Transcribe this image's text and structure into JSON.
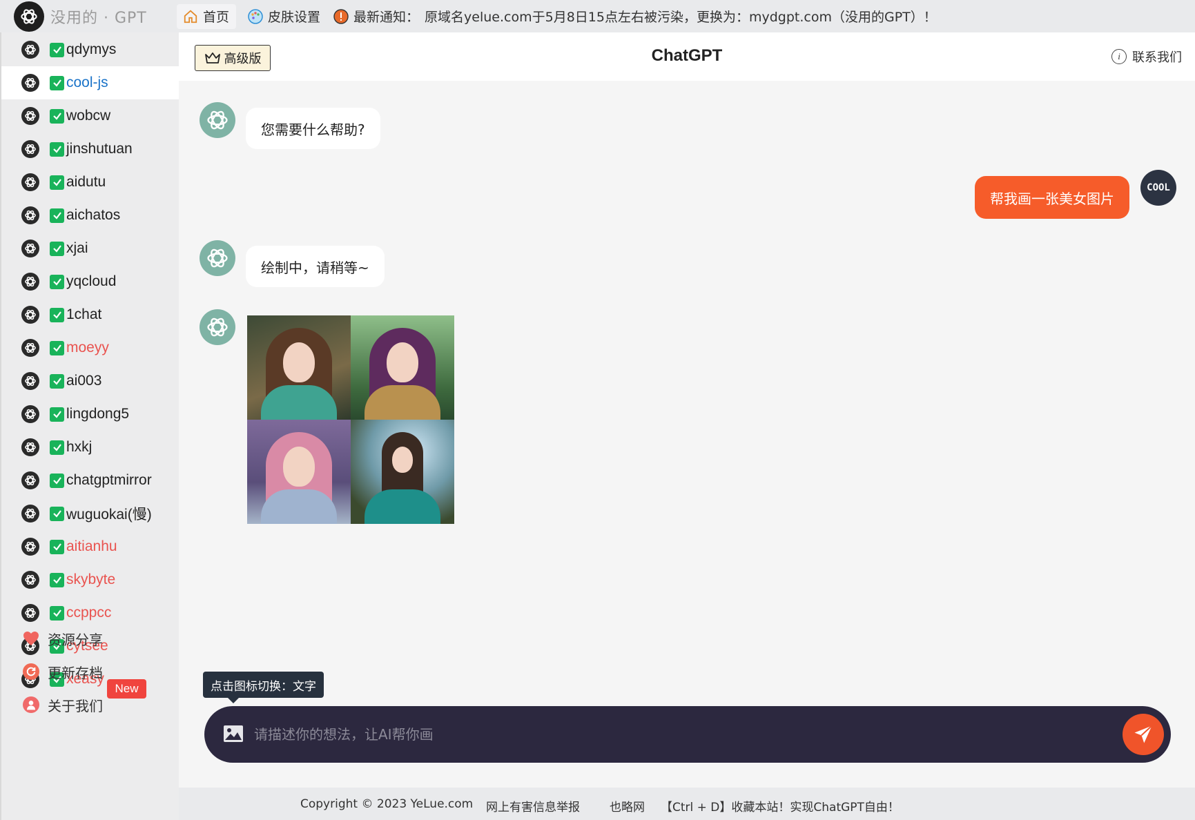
{
  "brand": {
    "name": "没用的 · GPT",
    "logo_icon": "openai-logo-icon"
  },
  "topnav": {
    "home": "首页",
    "skin": "皮肤设置",
    "notice_label": "最新通知：",
    "notice_text": "原域名yelue.com于5月8日15点左右被污染，更换为：mydgpt.com（没用的GPT）！"
  },
  "sidebar": {
    "items": [
      {
        "label": "qdymys",
        "color": "#222222"
      },
      {
        "label": "cool-js",
        "color": "#1a73c8",
        "active": true
      },
      {
        "label": "wobcw",
        "color": "#222222"
      },
      {
        "label": "jinshutuan",
        "color": "#222222"
      },
      {
        "label": "aidutu",
        "color": "#222222"
      },
      {
        "label": "aichatos",
        "color": "#222222"
      },
      {
        "label": "xjai",
        "color": "#222222"
      },
      {
        "label": "yqcloud",
        "color": "#222222"
      },
      {
        "label": "1chat",
        "color": "#222222"
      },
      {
        "label": "moeyy",
        "color": "#e9534f"
      },
      {
        "label": "ai003",
        "color": "#222222"
      },
      {
        "label": "lingdong5",
        "color": "#222222"
      },
      {
        "label": "hxkj",
        "color": "#222222"
      },
      {
        "label": "chatgptmirror",
        "color": "#222222"
      },
      {
        "label": "wuguokai(慢)",
        "color": "#222222"
      },
      {
        "label": "aitianhu",
        "color": "#e9534f"
      },
      {
        "label": "skybyte",
        "color": "#e9534f"
      },
      {
        "label": "ccppcc",
        "color": "#e9534f"
      },
      {
        "label": "cytsee",
        "color": "#e9534f"
      },
      {
        "label": "xeasy",
        "color": "#e9534f"
      }
    ],
    "new_badge": "New",
    "links": [
      {
        "label": "资源分享",
        "icon": "heart-icon"
      },
      {
        "label": "更新存档",
        "icon": "refresh-icon"
      },
      {
        "label": "关于我们",
        "icon": "user-icon"
      }
    ]
  },
  "header": {
    "pro_label": "高级版",
    "title": "ChatGPT",
    "contact": "联系我们"
  },
  "messages": [
    {
      "role": "assistant",
      "text": "您需要什么帮助?"
    },
    {
      "role": "user",
      "text": "帮我画一张美女图片",
      "avatar_text": "COOL"
    },
    {
      "role": "assistant",
      "text": "绘制中，请稍等~"
    },
    {
      "role": "assistant",
      "image": "generated-portrait-grid"
    }
  ],
  "composer": {
    "tooltip": "点击图标切换：文字",
    "placeholder": "请描述你的想法，让AI帮你画"
  },
  "footer": {
    "copyright": "Copyright © 2023 YeLue.com",
    "report": "网上有害信息举报",
    "site": "也略网",
    "bookmark": "【Ctrl + D】收藏本站！实现ChatGPT自由！"
  },
  "colors": {
    "accent": "#f65c2a",
    "composer_bg": "#2c283f",
    "check_green": "#19b35a",
    "ai_avatar": "#7fb3a5"
  }
}
